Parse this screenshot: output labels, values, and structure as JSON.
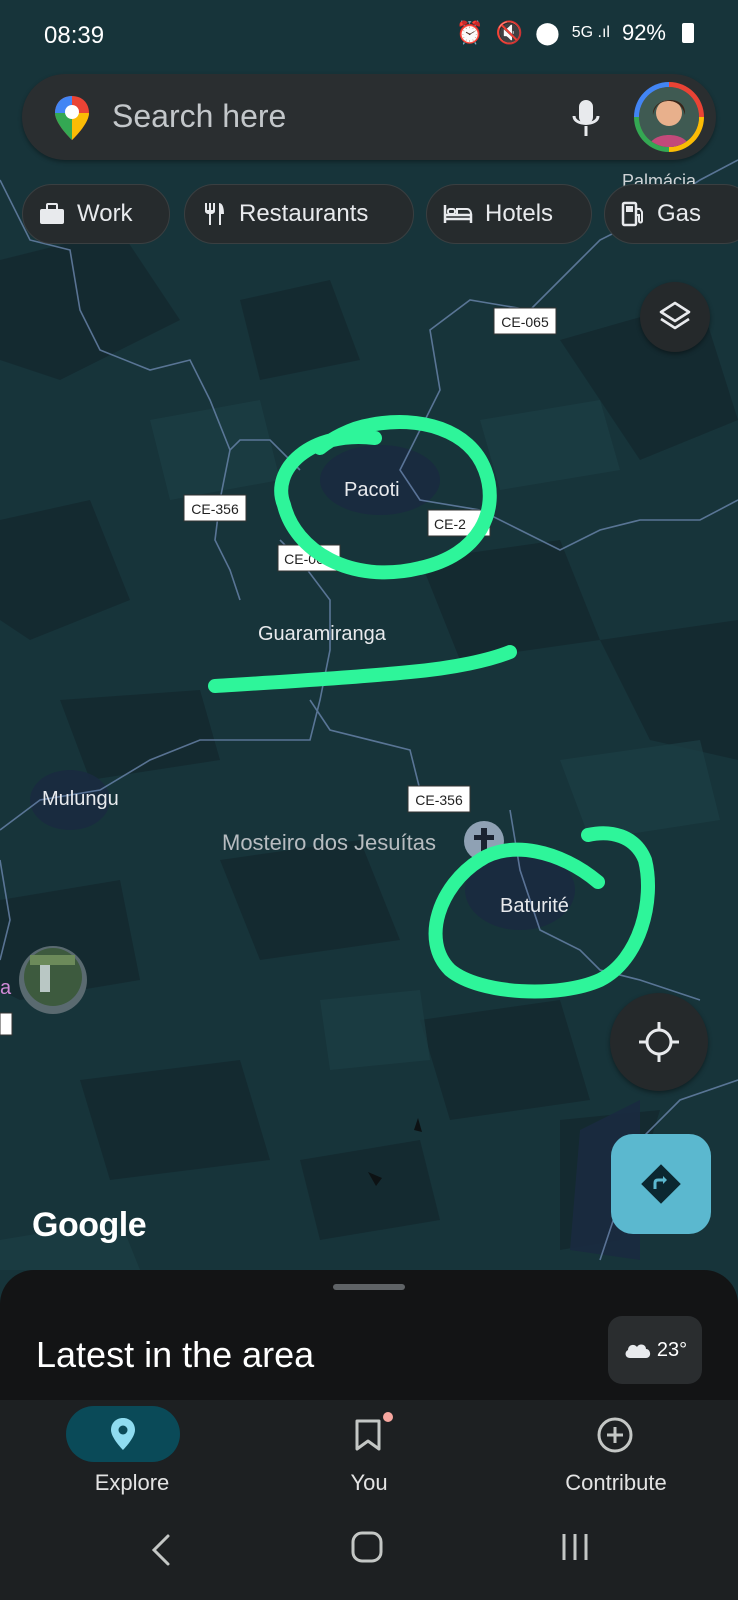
{
  "status_bar": {
    "time": "08:39",
    "battery": "92%"
  },
  "search": {
    "placeholder": "Search here"
  },
  "chips": [
    {
      "label": "Work",
      "icon": "briefcase-icon"
    },
    {
      "label": "Restaurants",
      "icon": "fork-knife-icon"
    },
    {
      "label": "Hotels",
      "icon": "bed-icon"
    },
    {
      "label": "Gas",
      "icon": "gas-pump-icon"
    }
  ],
  "map": {
    "places": [
      "Pacoti",
      "Guaramiranga",
      "Mulungu",
      "Mosteiro dos Jesuítas",
      "Baturité",
      "Palmácia"
    ],
    "road_shields": [
      "CE-065",
      "CE-356",
      "CE-2",
      "CE-06",
      "CE-356"
    ],
    "attribution": "Google",
    "annotation_color": "#2ef59a"
  },
  "bottom_sheet": {
    "title": "Latest in the area",
    "temperature": "23°"
  },
  "bottom_nav": [
    {
      "label": "Explore",
      "icon": "location-pin-icon",
      "active": true
    },
    {
      "label": "You",
      "icon": "bookmark-icon"
    },
    {
      "label": "Contribute",
      "icon": "add-circle-icon"
    }
  ]
}
